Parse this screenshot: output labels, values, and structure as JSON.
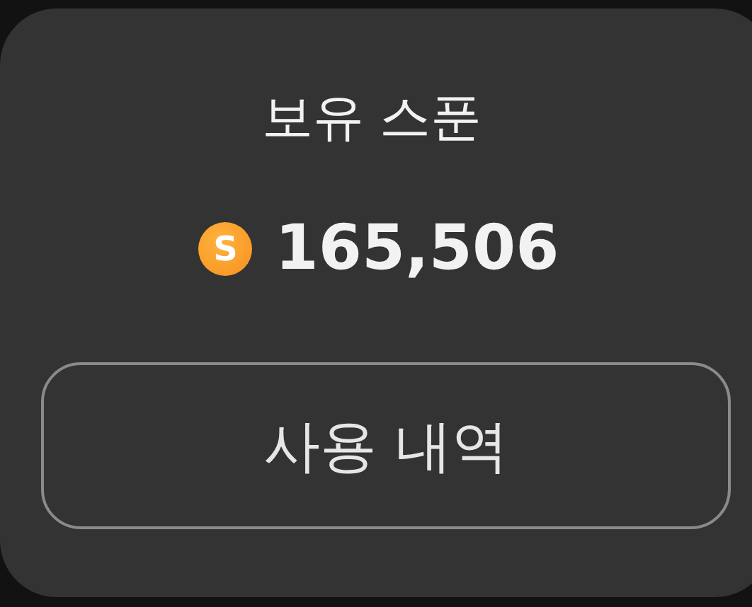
{
  "title": "보유 스푼",
  "balance": {
    "icon_letter": "S",
    "amount": "165,506"
  },
  "button": "사용 내역"
}
